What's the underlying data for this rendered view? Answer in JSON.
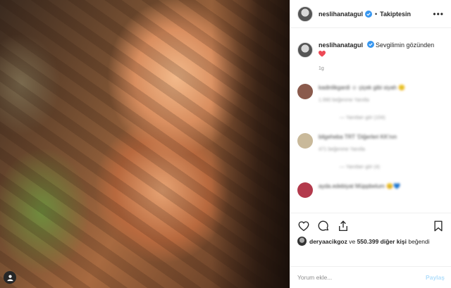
{
  "header": {
    "username": "neslihanatagul",
    "separator": "•",
    "follow_label": "Takiptesin",
    "more_label": "•••"
  },
  "caption": {
    "username": "neslihanatagul",
    "text": "Sevgilimin gözünden",
    "time": "1g"
  },
  "comments": [
    {
      "text": "kadinlikgardi ☺ çiçek gibi siyah 🙂",
      "meta": "1.990 beğenme   Yanıtla",
      "replies": "— Yanıtları gör (104)",
      "avatar_color": "#8a5a4c"
    },
    {
      "text": "bilgeheba  TRT 'Diğerleri KK'nın",
      "meta": "471 beğenme   Yanıtla",
      "replies": "— Yanıtları gör (4)",
      "avatar_color": "#c9b99a"
    },
    {
      "text": "ayda.edebiyat Müppbelum 😊💙",
      "avatar_color": "#b33a4c"
    }
  ],
  "likes": {
    "first_user": "deryaacikgoz",
    "middle": " ve ",
    "count": "550.399 diğer kişi",
    "suffix": " beğendi"
  },
  "comment_input": {
    "placeholder": "Yorum ekle...",
    "post_label": "Paylaş"
  },
  "icons": {
    "like": "heart-icon",
    "comment": "comment-icon",
    "share": "share-icon",
    "save": "bookmark-icon",
    "verified": "verified-badge-icon",
    "tag": "user-tag-icon"
  },
  "colors": {
    "verified": "#3897f0",
    "heart": "#ed4956",
    "text": "#262626",
    "muted": "#8e8e8e"
  }
}
